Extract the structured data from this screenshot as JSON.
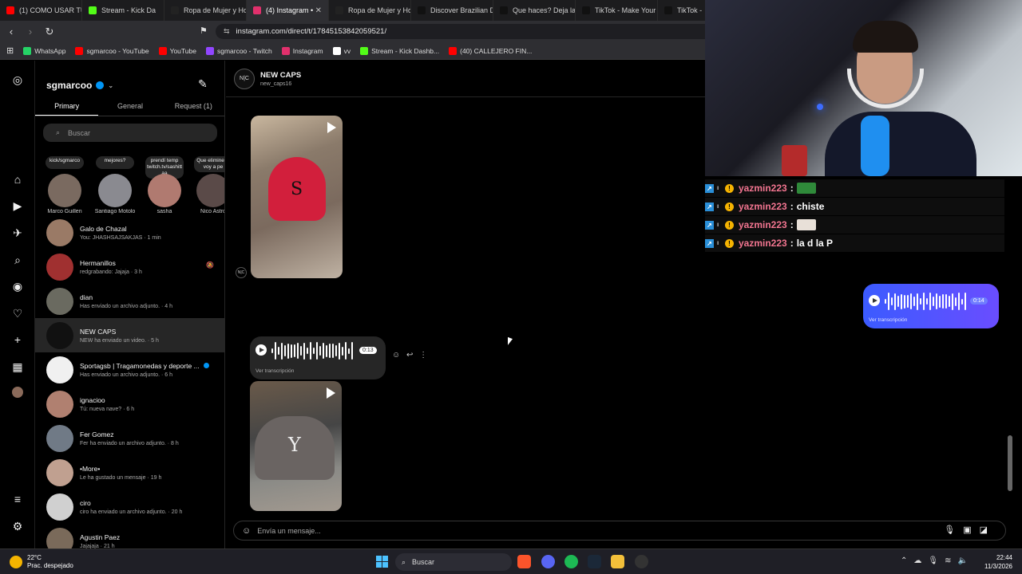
{
  "browser": {
    "tabs": [
      {
        "label": "(1) COMO USAR TU",
        "color": "#ff0000"
      },
      {
        "label": "Stream - Kick Da",
        "color": "#53fc18"
      },
      {
        "label": "Ropa de Mujer y Ho",
        "color": "#222222"
      },
      {
        "label": "(4) Instagram •",
        "color": "#e1306c",
        "active": true
      },
      {
        "label": "Ropa de Mujer y Ho",
        "color": "#222222"
      },
      {
        "label": "Discover Brazilian D",
        "color": "#111111"
      },
      {
        "label": "Que haces? Deja la",
        "color": "#111111"
      },
      {
        "label": "TikTok - Make Your",
        "color": "#111111"
      },
      {
        "label": "TikTok -",
        "color": "#111111"
      }
    ],
    "url": "instagram.com/direct/t/17845153842059521/",
    "bookmarks": [
      {
        "label": "WhatsApp",
        "color": "#25d366"
      },
      {
        "label": "sgmarcoo - YouTube",
        "color": "#ff0000"
      },
      {
        "label": "YouTube",
        "color": "#ff0000"
      },
      {
        "label": "sgmarcoo - Twitch",
        "color": "#9146ff"
      },
      {
        "label": "Instagram",
        "color": "#e1306c"
      },
      {
        "label": "vv",
        "color": "#ffffff"
      },
      {
        "label": "Stream - Kick Dashb...",
        "color": "#53fc18"
      },
      {
        "label": "(40) CALLEJERO FIN...",
        "color": "#ff0000"
      }
    ]
  },
  "inbox": {
    "username": "sgmarcoo",
    "tabs": {
      "primary": "Primary",
      "general": "General",
      "requests": "Request (1)"
    },
    "search_placeholder": "Buscar",
    "notes": [
      {
        "bubble": "kick/sgmarco",
        "name": "Marco Guillen",
        "color": "#7a6a60"
      },
      {
        "bubble": "mejores?",
        "name": "Santiago Motolo",
        "color": "#8a8a90"
      },
      {
        "bubble": "prendí temp twitch.tv/sashitt aa",
        "name": "sasha",
        "color": "#b07a70"
      },
      {
        "bubble": "Que elimine le voy a pe",
        "name": "Nico Astro",
        "color": "#5a4a48"
      }
    ],
    "conversations": [
      {
        "name": "Galo de Chazal",
        "sub": "You: JHASHSAJSAKJAS · 1 min",
        "color": "#9a7a66"
      },
      {
        "name": "Hermanillos",
        "sub": "redgrabando: Jajaja · 3 h",
        "color": "#a03030",
        "muted": true
      },
      {
        "name": "dian",
        "sub": "Has enviado un archivo adjunto. · 4 h",
        "color": "#6a6a60"
      },
      {
        "name": "NEW CAPS",
        "sub": "NEW ha enviado un video. · 5 h",
        "color": "#111111",
        "selected": true
      },
      {
        "name": "Sportagsb | Tragamonedas y deporte ...",
        "sub": "Has enviado un archivo adjunto. · 6 h",
        "color": "#f0f0f0",
        "verified": true
      },
      {
        "name": "ignacioo",
        "sub": "Tú: nueva nave? · 6 h",
        "color": "#b08070"
      },
      {
        "name": "Fer Gomez",
        "sub": "Fer ha enviado un archivo adjunto. · 8 h",
        "color": "#707a86"
      },
      {
        "name": "•More•",
        "sub": "Le ha gustado un mensaje · 19 h",
        "color": "#c0a090"
      },
      {
        "name": "ciro",
        "sub": "ciro ha enviado un archivo adjunto. · 20 h",
        "color": "#d0d0d0"
      },
      {
        "name": "Agustin Paez",
        "sub": "Jajajaja · 21 h",
        "color": "#7a6a5a"
      }
    ]
  },
  "chat": {
    "name": "NEW CAPS",
    "username": "new_caps16",
    "audio_in": {
      "time": "0:13",
      "transcription": "Ver transcripción"
    },
    "audio_out": {
      "time": "0:14",
      "transcription": "Ver transcripción"
    },
    "composer_placeholder": "Envía un mensaje..."
  },
  "stream_chat": [
    {
      "user": "yazmin223",
      "msg": "",
      "emote": "#2f8a3a"
    },
    {
      "user": "yazmin223",
      "msg": "chiste",
      "emote": ""
    },
    {
      "user": "yazmin223",
      "msg": "",
      "emote": "#e8e0d8"
    },
    {
      "user": "yazmin223",
      "msg": "la d la P",
      "emote": ""
    }
  ],
  "taskbar": {
    "temp": "22°C",
    "weather": "Prac. despejado",
    "search": "Buscar",
    "time": "22:44",
    "date": "11/3/2026"
  }
}
